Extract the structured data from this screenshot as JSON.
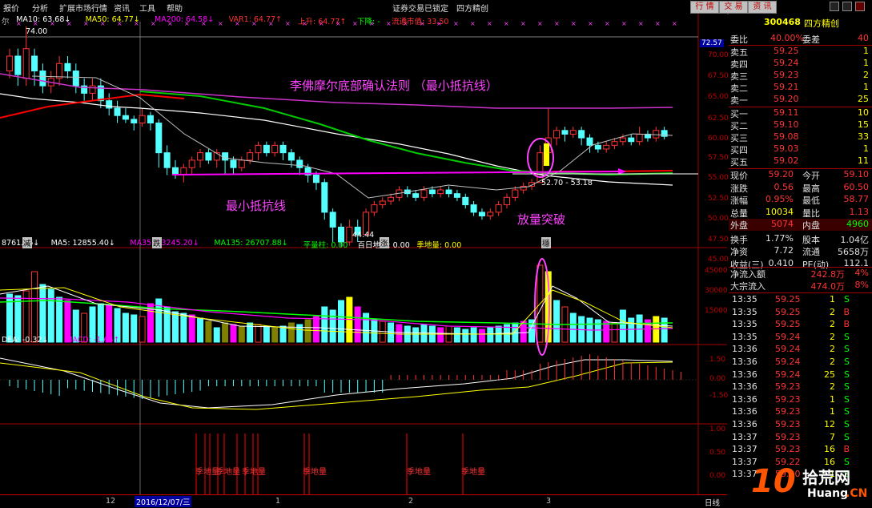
{
  "menu": {
    "items": [
      "报价",
      "分析",
      "扩展市场行情",
      "资讯",
      "工具",
      "帮助"
    ],
    "center": "证券交易已锁定",
    "app": "四方精创",
    "buttons": [
      "行 情",
      "交 易",
      "资 讯"
    ]
  },
  "price_panel": {
    "legend": [
      {
        "t": "尔",
        "c": "#c0c0c0"
      },
      {
        "t": "MA10: 63.68↓",
        "c": "#ffffff"
      },
      {
        "t": "MA50: 64.77↓",
        "c": "#ffff00"
      },
      {
        "t": "MA200: 64.58↓",
        "c": "#ff00ff"
      },
      {
        "t": "VAR1: 64.77↑",
        "c": "#ff3333"
      },
      {
        "t": "上升: 64.77↑",
        "c": "#ff3333"
      },
      {
        "t": "下降: -",
        "c": "#00ff00"
      },
      {
        "t": "流通市值: 33.50",
        "c": "#ff3333"
      }
    ],
    "title": "李佛摩尔底部确认法则 （最小抵抗线）",
    "ann_line": "最小抵抗线",
    "ann_break": "放量突破",
    "hi_label": "74.00",
    "lo_label": "44.44",
    "range_label": "52.70 - 53.18",
    "marks": [
      "减",
      "跌",
      "涨",
      "穩"
    ],
    "axis": [
      "72.57",
      "70.00",
      "67.50",
      "65.00",
      "62.50",
      "60.00",
      "57.50",
      "55.00",
      "52.50",
      "50.00",
      "47.50",
      "45.00"
    ]
  },
  "vol_panel": {
    "legend": [
      {
        "t": "8761.56↓",
        "c": "#ffffff"
      },
      {
        "t": "MA5: 12855.40↓",
        "c": "#ffffff"
      },
      {
        "t": "MA35: 23245.20↓",
        "c": "#ff00ff"
      },
      {
        "t": "MA135: 26707.88↓",
        "c": "#00ff00"
      },
      {
        "t": "平量柱: 0.00",
        "c": "#00ff00"
      },
      {
        "t": "百日地量: 0.00",
        "c": "#ffffff"
      },
      {
        "t": "季地量: 0.00",
        "c": "#ffff00"
      }
    ],
    "axis": [
      "45000",
      "30000",
      "15000"
    ]
  },
  "macd_panel": {
    "legend": [
      {
        "t": "DEA: -0.32↓",
        "c": "#ffffff"
      },
      {
        "t": "MACD: -1.66↑",
        "c": "#ff00ff"
      }
    ],
    "axis": [
      "1.50",
      "0.00",
      "-1.50"
    ]
  },
  "signal_panel": {
    "axis": [
      "1.00",
      "0.50",
      "0.00"
    ],
    "signals": [
      "季地量",
      "季地量",
      "季地量",
      "季地量",
      "季地量",
      "季地量",
      "季地量",
      "季地量",
      "季地量",
      "季地量"
    ]
  },
  "datebar": {
    "labels": [
      "12",
      "2016/12/07/三",
      "1",
      "2",
      "3"
    ],
    "cycle": "日线"
  },
  "quote": {
    "code": "300468",
    "name": "四方精创",
    "weibi_label": "委比",
    "weibi": "40.00%",
    "weicha_label": "委差",
    "weicha": "40",
    "sells": [
      {
        "l": "卖五",
        "p": "59.25",
        "v": "1"
      },
      {
        "l": "卖四",
        "p": "59.24",
        "v": "1"
      },
      {
        "l": "卖三",
        "p": "59.23",
        "v": "2"
      },
      {
        "l": "卖二",
        "p": "59.21",
        "v": "1"
      },
      {
        "l": "卖一",
        "p": "59.20",
        "v": "25"
      }
    ],
    "buys": [
      {
        "l": "买一",
        "p": "59.11",
        "v": "10"
      },
      {
        "l": "买二",
        "p": "59.10",
        "v": "15"
      },
      {
        "l": "买三",
        "p": "59.08",
        "v": "33"
      },
      {
        "l": "买四",
        "p": "59.03",
        "v": "1"
      },
      {
        "l": "买五",
        "p": "59.02",
        "v": "11"
      }
    ],
    "stats": [
      {
        "a": "现价",
        "av": "59.20",
        "b": "今开",
        "bv": "59.10",
        "ac": "#ff3333",
        "bc": "#ff3333"
      },
      {
        "a": "涨跌",
        "av": "0.56",
        "b": "最高",
        "bv": "60.50",
        "ac": "#ff3333",
        "bc": "#ff3333"
      },
      {
        "a": "涨幅",
        "av": "0.95%",
        "b": "最低",
        "bv": "58.77",
        "ac": "#ff3333",
        "bc": "#ff3333"
      },
      {
        "a": "总量",
        "av": "10034",
        "b": "量比",
        "bv": "1.13",
        "ac": "#ffff00",
        "bc": "#ff3333"
      },
      {
        "a": "外盘",
        "av": "5074",
        "b": "内盘",
        "bv": "4960",
        "ac": "#ff3333",
        "bc": "#00ff00",
        "hl": true
      },
      {
        "a": "换手",
        "av": "1.77%",
        "b": "股本",
        "bv": "1.04亿",
        "ac": "#e0e0e0",
        "bc": "#e0e0e0"
      },
      {
        "a": "净资",
        "av": "7.72",
        "b": "流通",
        "bv": "5658万",
        "ac": "#e0e0e0",
        "bc": "#e0e0e0"
      },
      {
        "a": "收益(三)",
        "av": "0.410",
        "b": "PE(动)",
        "bv": "112.1",
        "ac": "#e0e0e0",
        "bc": "#e0e0e0"
      }
    ],
    "flows": [
      {
        "l": "净流入额",
        "v": "242.8万",
        "p": "4%"
      },
      {
        "l": "大宗流入",
        "v": "474.0万",
        "p": "8%"
      }
    ],
    "ticks": [
      [
        "13:35",
        "59.25",
        "1",
        "S"
      ],
      [
        "13:35",
        "59.25",
        "2",
        "B"
      ],
      [
        "13:35",
        "59.25",
        "2",
        "B"
      ],
      [
        "13:35",
        "59.24",
        "2",
        "S"
      ],
      [
        "13:36",
        "59.24",
        "2",
        "S"
      ],
      [
        "13:36",
        "59.24",
        "2",
        "S"
      ],
      [
        "13:36",
        "59.24",
        "25",
        "S"
      ],
      [
        "13:36",
        "59.23",
        "2",
        "S"
      ],
      [
        "13:36",
        "59.23",
        "1",
        "S"
      ],
      [
        "13:36",
        "59.23",
        "1",
        "S"
      ],
      [
        "13:36",
        "59.23",
        "12",
        "S"
      ],
      [
        "13:37",
        "59.23",
        "7",
        "S"
      ],
      [
        "13:37",
        "59.23",
        "16",
        "B"
      ],
      [
        "13:37",
        "59.22",
        "16",
        "S"
      ],
      [
        "13:37",
        "59.20",
        "1",
        "S"
      ]
    ]
  },
  "watermark": {
    "big": "10",
    "a": "拾荒网",
    "b": "Huang",
    "c": ".CN"
  },
  "colors": {
    "up": "#ff3333",
    "down": "#54ffff",
    "ma10": "#ffffff",
    "ma50": "#00cc00",
    "ma200": "#cc33cc",
    "red": "#ff0000",
    "yellow": "#ffff00",
    "magenta": "#ff00ff"
  }
}
